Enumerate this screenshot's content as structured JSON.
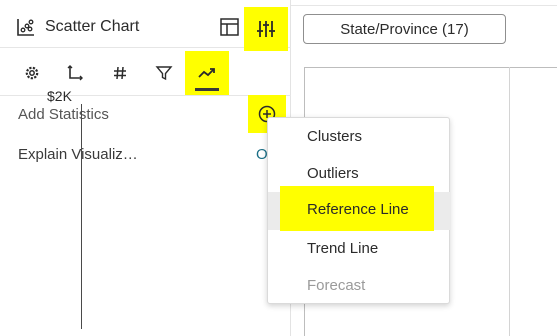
{
  "panel": {
    "title": "Scatter Chart",
    "tabs": [
      {
        "icon": "gear-icon"
      },
      {
        "icon": "axis-icon"
      },
      {
        "icon": "hash-icon"
      },
      {
        "icon": "filter-icon"
      },
      {
        "icon": "trend-icon",
        "active": true
      }
    ],
    "add_statistics_label": "Add Statistics",
    "explain_label": "Explain Visualiz…",
    "explain_trailing": "O"
  },
  "toolbar": {
    "state_button_label": "State/Province (17)"
  },
  "chart": {
    "y_tick_label": "$2K"
  },
  "menu": {
    "items": [
      {
        "label": "Clusters",
        "enabled": true
      },
      {
        "label": "Outliers",
        "enabled": true
      },
      {
        "label": "Reference Line",
        "enabled": true,
        "highlighted": true
      },
      {
        "label": "Trend Line",
        "enabled": true
      },
      {
        "label": "Forecast",
        "enabled": false
      }
    ]
  },
  "colors": {
    "highlight": "#ffff00",
    "link": "#1a6e86",
    "disabled_text": "#9a9a9a"
  }
}
